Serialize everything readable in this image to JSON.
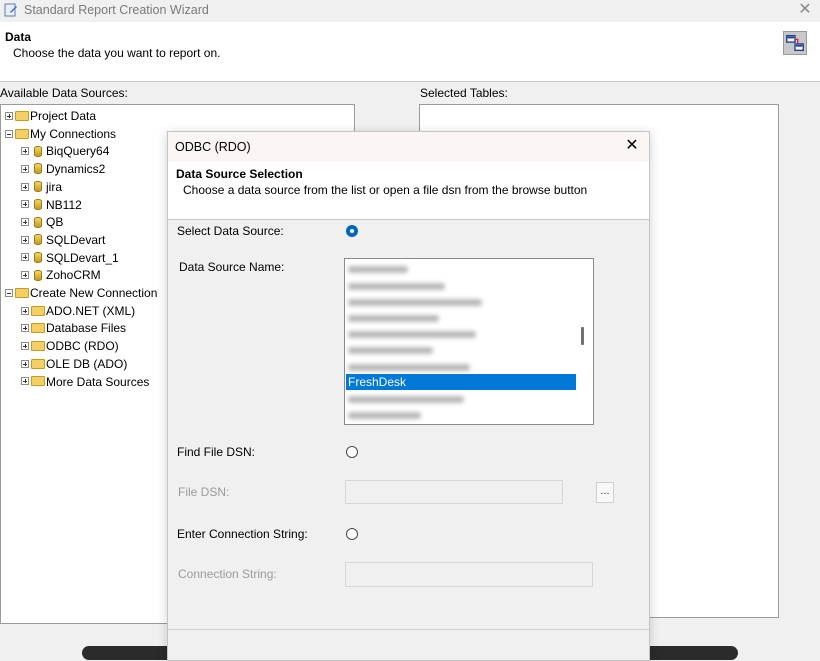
{
  "window": {
    "title": "Standard Report Creation Wizard"
  },
  "header": {
    "title": "Data",
    "subtitle": "Choose the data you want to report on."
  },
  "labels": {
    "available": "Available Data Sources:",
    "selected": "Selected Tables:"
  },
  "tree": [
    {
      "label": "Project Data",
      "level": 0,
      "kind": "folder",
      "expander": "plus"
    },
    {
      "label": "My Connections",
      "level": 0,
      "kind": "folder",
      "expander": "minus"
    },
    {
      "label": "BiqQuery64",
      "level": 1,
      "kind": "db",
      "expander": "plus"
    },
    {
      "label": "Dynamics2",
      "level": 1,
      "kind": "db",
      "expander": "plus"
    },
    {
      "label": "jira",
      "level": 1,
      "kind": "db",
      "expander": "plus"
    },
    {
      "label": "NB112",
      "level": 1,
      "kind": "db",
      "expander": "plus"
    },
    {
      "label": "QB",
      "level": 1,
      "kind": "db",
      "expander": "plus"
    },
    {
      "label": "SQLDevart",
      "level": 1,
      "kind": "db",
      "expander": "plus"
    },
    {
      "label": "SQLDevart_1",
      "level": 1,
      "kind": "db",
      "expander": "plus"
    },
    {
      "label": "ZohoCRM",
      "level": 1,
      "kind": "db",
      "expander": "plus"
    },
    {
      "label": "Create New Connection",
      "level": 0,
      "kind": "folder",
      "expander": "minus"
    },
    {
      "label": "ADO.NET (XML)",
      "level": 1,
      "kind": "folder",
      "expander": "plus"
    },
    {
      "label": "Database Files",
      "level": 1,
      "kind": "folder",
      "expander": "plus"
    },
    {
      "label": "ODBC (RDO)",
      "level": 1,
      "kind": "folder",
      "expander": "plus"
    },
    {
      "label": "OLE DB (ADO)",
      "level": 1,
      "kind": "folder",
      "expander": "plus"
    },
    {
      "label": "More Data Sources",
      "level": 1,
      "kind": "folder",
      "expander": "plus"
    }
  ],
  "dialog": {
    "title": "ODBC (RDO)",
    "head_title": "Data Source Selection",
    "head_subtitle": "Choose a data source from the list or open a file dsn from the browse button",
    "select_data_source_label": "Select Data Source:",
    "data_source_name_label": "Data Source Name:",
    "dsn_items": [
      "",
      "",
      "",
      "",
      "",
      "",
      "",
      "FreshDesk",
      "",
      ""
    ],
    "selected_dsn_index": 7,
    "find_file_dsn_label": "Find File DSN:",
    "file_dsn_label": "File DSN:",
    "file_dsn_value": "",
    "browse_label": "...",
    "enter_connection_string_label": "Enter Connection String:",
    "connection_string_label": "Connection String:",
    "connection_string_value": "",
    "selected_option": "select_data_source"
  },
  "icons": {
    "app": "wizard-app-icon",
    "close": "close-icon",
    "header": "data-link-icon"
  }
}
